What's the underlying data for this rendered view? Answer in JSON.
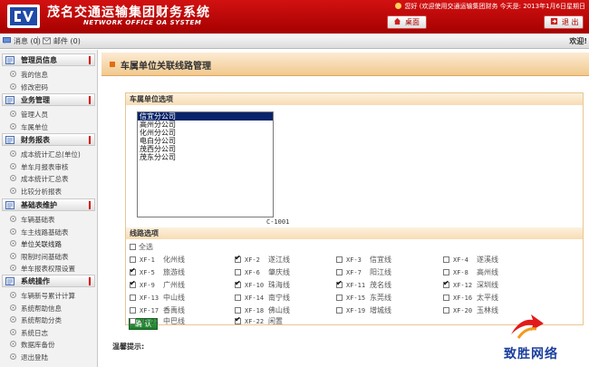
{
  "header": {
    "system_title": "茂名交通运输集团财务系统",
    "system_subtitle": "NETWORK OFFICE OA SYSTEM",
    "welcome": "您好 (欢迎使用交通运输集团财务    今天是: 2013年1月6日星期日",
    "desktop_label": "桌面",
    "exit_label": "退 出"
  },
  "subbar": {
    "messages_label": "消息 (0)",
    "mail_label": "邮件 (0)",
    "welcome": "欢迎!"
  },
  "sidebar": {
    "sections": [
      {
        "title": "管理员信息",
        "items": [
          "我的信息",
          "修改密码"
        ]
      },
      {
        "title": "业务管理",
        "items": [
          "管理人员",
          "车属单位"
        ]
      },
      {
        "title": "财务报表",
        "items": [
          "成本统计汇总(单位)",
          "单车月报表审核",
          "成本统计汇总表",
          "比较分析报表"
        ]
      },
      {
        "title": "基础表维护",
        "items": [
          "车辆基础表",
          "车主线路基础表",
          "单位关联线路",
          "限制时间基础表",
          "单车报表权限设置"
        ]
      },
      {
        "title": "系统操作",
        "items": [
          "车辆新号累计计算",
          "系统帮助信息",
          "系统帮助分类",
          "系统日志",
          "数据库备份",
          "退出登陆"
        ]
      }
    ]
  },
  "main": {
    "title": "车属单位关联线路管理",
    "unit_group_label": "车属单位选项",
    "units": [
      "信宜分公司",
      "高州分公司",
      "化州分公司",
      "电白分公司",
      "茂西分公司",
      "茂东分公司"
    ],
    "selected_unit": "信宜分公司",
    "unit_code": "C-1001",
    "route_group_label": "线路选项",
    "select_all_label": "全选",
    "routes": [
      {
        "code": "XF-1",
        "name": "化州线",
        "checked": false
      },
      {
        "code": "XF-2",
        "name": "遂江线",
        "checked": true
      },
      {
        "code": "XF-3",
        "name": "信宜线",
        "checked": false
      },
      {
        "code": "XF-4",
        "name": "遂溪线",
        "checked": false
      },
      {
        "code": "XF-5",
        "name": "旅游线",
        "checked": true
      },
      {
        "code": "XF-6",
        "name": "肇庆线",
        "checked": false
      },
      {
        "code": "XF-7",
        "name": "阳江线",
        "checked": false
      },
      {
        "code": "XF-8",
        "name": "高州线",
        "checked": false
      },
      {
        "code": "XF-9",
        "name": "广州线",
        "checked": true
      },
      {
        "code": "XF-10",
        "name": "珠海线",
        "checked": true
      },
      {
        "code": "XF-11",
        "name": "茂名线",
        "checked": true
      },
      {
        "code": "XF-12",
        "name": "深圳线",
        "checked": true
      },
      {
        "code": "XF-13",
        "name": "中山线",
        "checked": false
      },
      {
        "code": "XF-14",
        "name": "南宁线",
        "checked": false
      },
      {
        "code": "XF-15",
        "name": "东莞线",
        "checked": false
      },
      {
        "code": "XF-16",
        "name": "太平线",
        "checked": false
      },
      {
        "code": "XF-17",
        "name": "香禹线",
        "checked": false
      },
      {
        "code": "XF-18",
        "name": "佛山线",
        "checked": false
      },
      {
        "code": "XF-19",
        "name": "增城线",
        "checked": false
      },
      {
        "code": "XF-20",
        "name": "玉林线",
        "checked": false
      },
      {
        "code": "XF-21",
        "name": "中巴线",
        "checked": false
      },
      {
        "code": "XF-22",
        "name": "闲置",
        "checked": true
      }
    ],
    "confirm_label": "确 认",
    "tips_label": "温馨提示:"
  },
  "brand": {
    "name": "致胜网络"
  },
  "colors": {
    "header_red": "#c20a0a",
    "accent_orange": "#e36d0d",
    "confirm_green": "#2a9a3a",
    "brand_blue": "#1c3f9e"
  }
}
